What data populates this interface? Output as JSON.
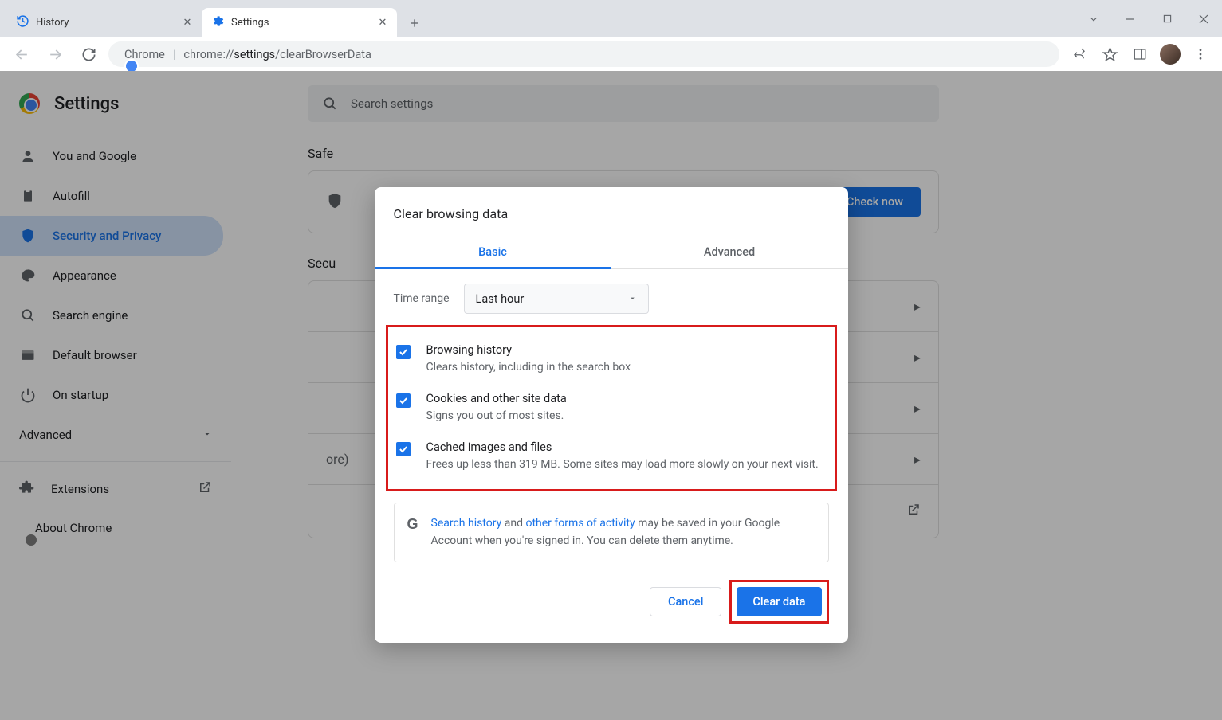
{
  "titlebar": {
    "tabs": [
      {
        "label": "History",
        "active": false
      },
      {
        "label": "Settings",
        "active": true
      }
    ]
  },
  "toolbar": {
    "url_chip": "Chrome",
    "url_prefix": "chrome://",
    "url_bold": "settings",
    "url_rest": "/clearBrowserData"
  },
  "sidebar": {
    "title": "Settings",
    "items": [
      {
        "label": "You and Google"
      },
      {
        "label": "Autofill"
      },
      {
        "label": "Security and Privacy"
      },
      {
        "label": "Appearance"
      },
      {
        "label": "Search engine"
      },
      {
        "label": "Default browser"
      },
      {
        "label": "On startup"
      }
    ],
    "advanced": "Advanced",
    "extensions": "Extensions",
    "about": "About Chrome"
  },
  "main": {
    "search_placeholder": "Search settings",
    "safety_heading_partial": "Safe",
    "check_now": "Check now",
    "security_heading_partial": "Secu",
    "more_text": "ore)"
  },
  "dialog": {
    "title": "Clear browsing data",
    "tabs": {
      "basic": "Basic",
      "advanced": "Advanced"
    },
    "time_range_label": "Time range",
    "time_range_value": "Last hour",
    "rows": [
      {
        "title": "Browsing history",
        "sub": "Clears history, including in the search box"
      },
      {
        "title": "Cookies and other site data",
        "sub": "Signs you out of most sites."
      },
      {
        "title": "Cached images and files",
        "sub": "Frees up less than 319 MB. Some sites may load more slowly on your next visit."
      }
    ],
    "info": {
      "link1": "Search history",
      "mid1": " and ",
      "link2": "other forms of activity",
      "rest": " may be saved in your Google Account when you're signed in. You can delete them anytime."
    },
    "cancel": "Cancel",
    "clear": "Clear data"
  }
}
